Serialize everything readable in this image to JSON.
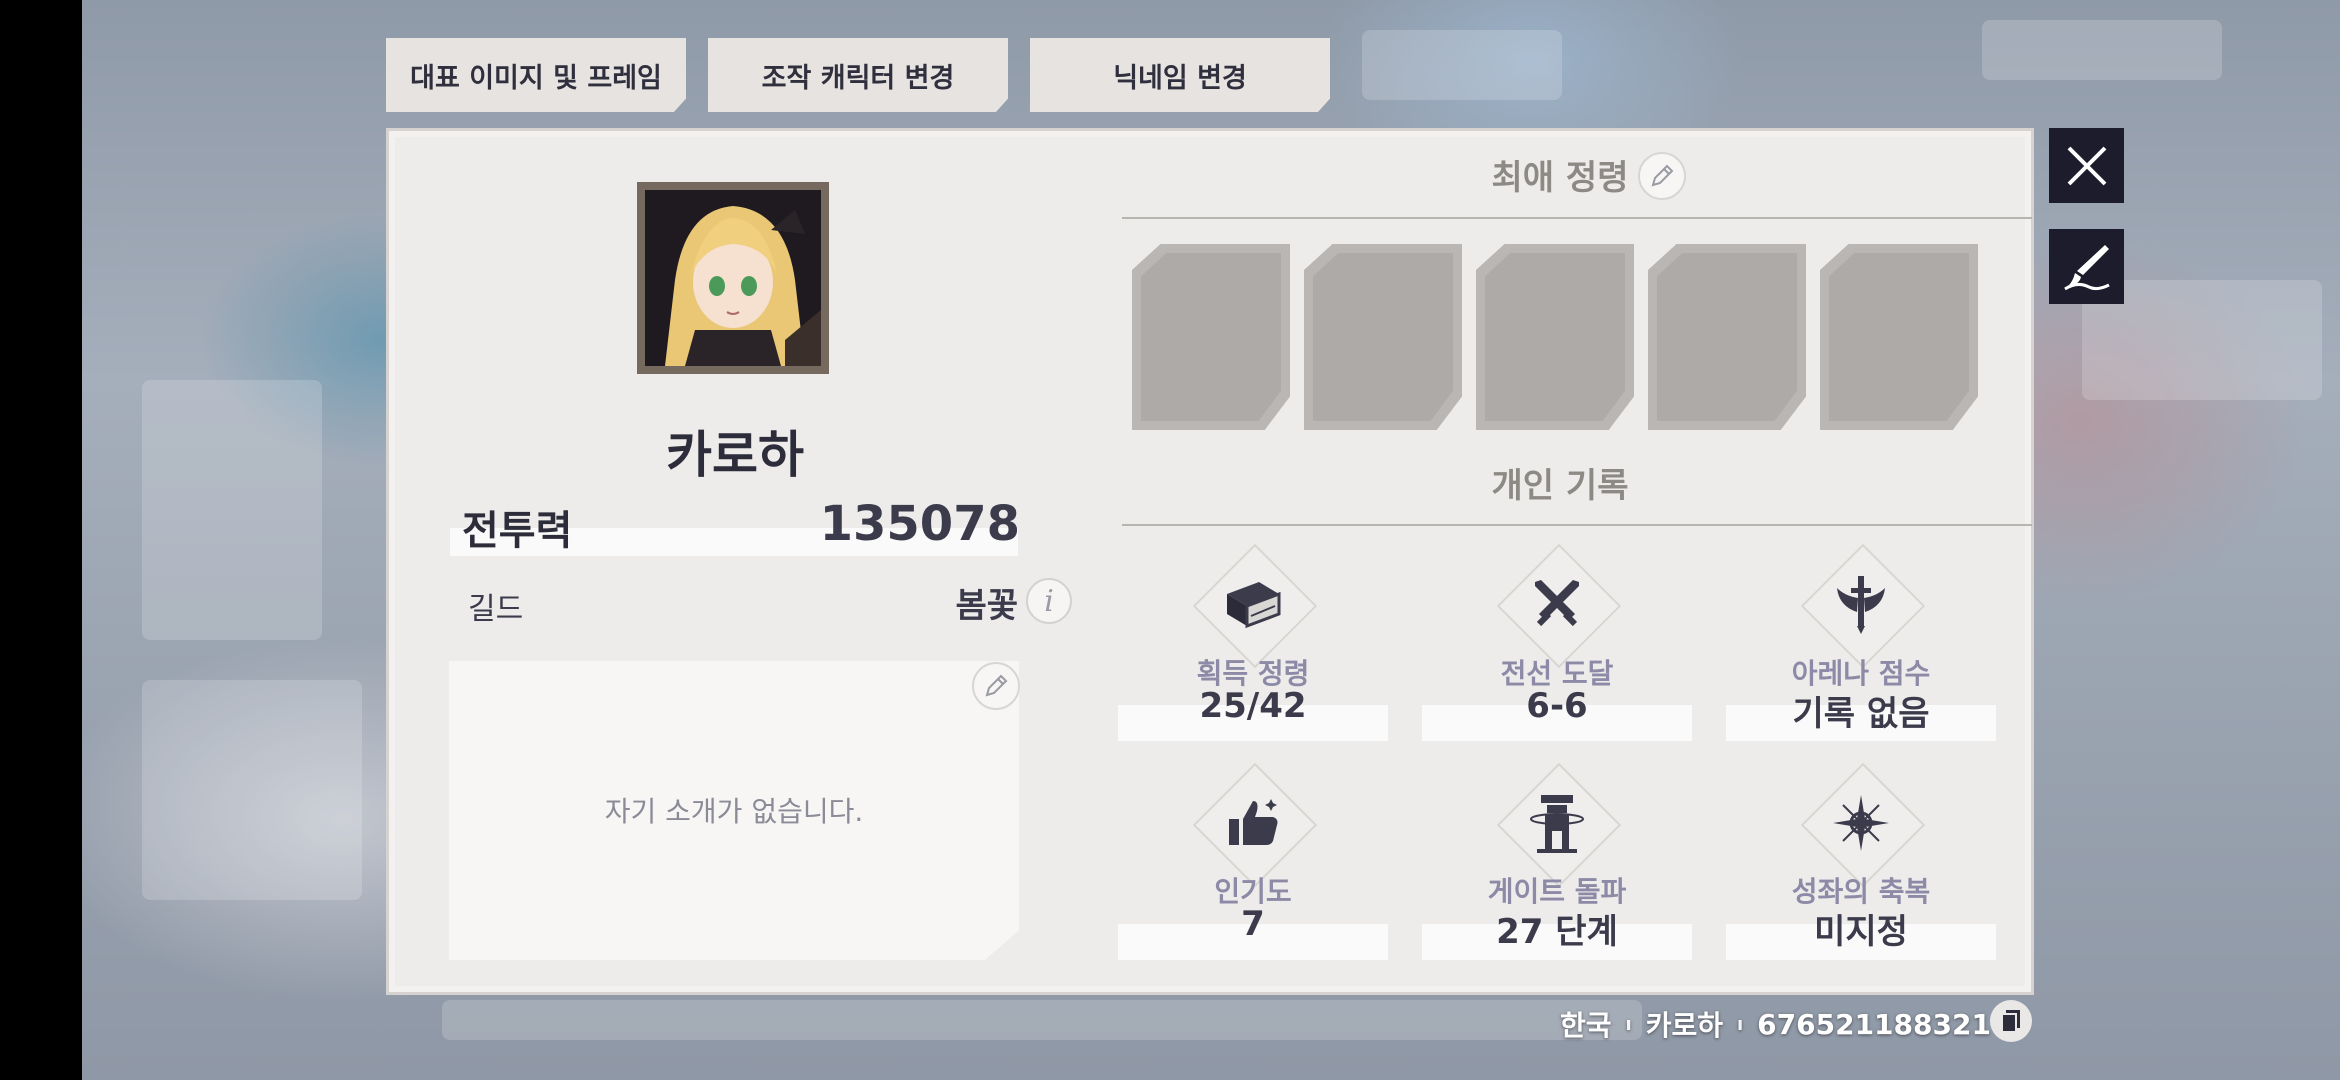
{
  "tabs": [
    "대표 이미지 및 프레임",
    "조작 캐릭터 변경",
    "닉네임 변경"
  ],
  "profile": {
    "name": "카로하",
    "power_label": "전투력",
    "power_value": "135078",
    "guild_label": "길드",
    "guild_value": "봄꽃",
    "bio_empty": "자기 소개가 없습니다."
  },
  "favorite": {
    "title": "최애 정령",
    "slots": 5
  },
  "records": {
    "title": "개인 기록",
    "stats": [
      {
        "label": "획득 정령",
        "value": "25/42",
        "icon": "book-icon"
      },
      {
        "label": "전선 도달",
        "value": "6-6",
        "icon": "crossed-swords-icon"
      },
      {
        "label": "아레나 점수",
        "value": "기록 없음",
        "icon": "winged-sword-icon"
      },
      {
        "label": "인기도",
        "value": "7",
        "icon": "thumbs-up-icon"
      },
      {
        "label": "게이트 돌파",
        "value": "27 단계",
        "icon": "gate-tower-icon"
      },
      {
        "label": "성좌의 축복",
        "value": "미지정",
        "icon": "compass-star-icon"
      }
    ]
  },
  "footer": {
    "region": "한국",
    "nickname": "카로하",
    "uid": "676521188321"
  },
  "colors": {
    "panel": "#eeecea",
    "text": "#3b3b4c",
    "accent_label": "#8c8aa6",
    "button_dark": "#1c1c2c"
  }
}
